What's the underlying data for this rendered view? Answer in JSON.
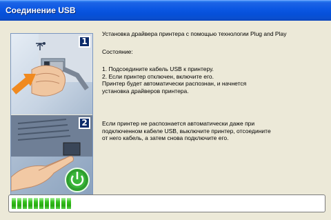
{
  "window": {
    "title": "Соединение USB"
  },
  "main": {
    "heading": "Установка драйвера принтера с помощью технологии Plug and Play",
    "state_label": "Состояние:",
    "steps": [
      "1. Подсоедините кабель USB к принтеру.",
      "2. Если принтер отключен, включите его.",
      "Принтер будет автоматически распознан, и начнется",
      "установка драйверов принтера."
    ],
    "note": [
      "Если принтер не распознается автоматически даже при",
      "подключенном кабеле USB, выключите принтер, отсоедините",
      "от него кабель, а затем снова подключите его."
    ]
  },
  "images": {
    "step1_badge": "1",
    "step2_badge": "2",
    "step1_icons": [
      "usb-icon"
    ],
    "step2_icons": [
      "power-icon"
    ]
  },
  "progress": {
    "fraction": 0.19
  },
  "colors": {
    "titlebar": "#0a56e2",
    "progress_fill": "#36c21f",
    "power_green": "#3ab53a"
  }
}
